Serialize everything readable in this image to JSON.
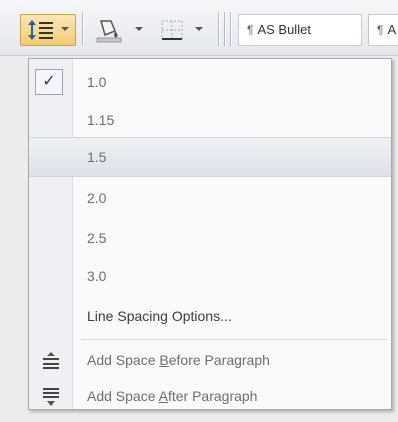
{
  "toolbar": {
    "line_spacing_button": {
      "icon": "line-spacing-icon",
      "pressed": true
    },
    "shading_button": {
      "icon": "paint-bucket-icon"
    },
    "borders_button": {
      "icon": "borders-icon"
    },
    "styles": [
      {
        "label": "AS Bullet",
        "marker": "¶"
      },
      {
        "label": "A",
        "marker": "¶"
      }
    ]
  },
  "menu": {
    "spacing_options": [
      {
        "label": "1.0",
        "checked": true
      },
      {
        "label": "1.15",
        "checked": false
      },
      {
        "label": "1.5",
        "checked": false,
        "hovered": true
      },
      {
        "label": "2.0",
        "checked": false
      },
      {
        "label": "2.5",
        "checked": false
      },
      {
        "label": "3.0",
        "checked": false
      }
    ],
    "check_mark": "✓",
    "line_spacing_options": "Line Spacing Options...",
    "add_space_before": {
      "pre": "Add Space ",
      "key": "B",
      "post": "efore Paragraph",
      "icon": "space-before-icon"
    },
    "add_space_after": {
      "pre": "Add Space ",
      "key": "A",
      "post": "fter Paragraph",
      "icon": "space-after-icon"
    }
  },
  "colors": {
    "accent_pressed": "#f2cd6e",
    "menu_text": "#6e6e6e",
    "hover_bg": "#dde2e9"
  }
}
